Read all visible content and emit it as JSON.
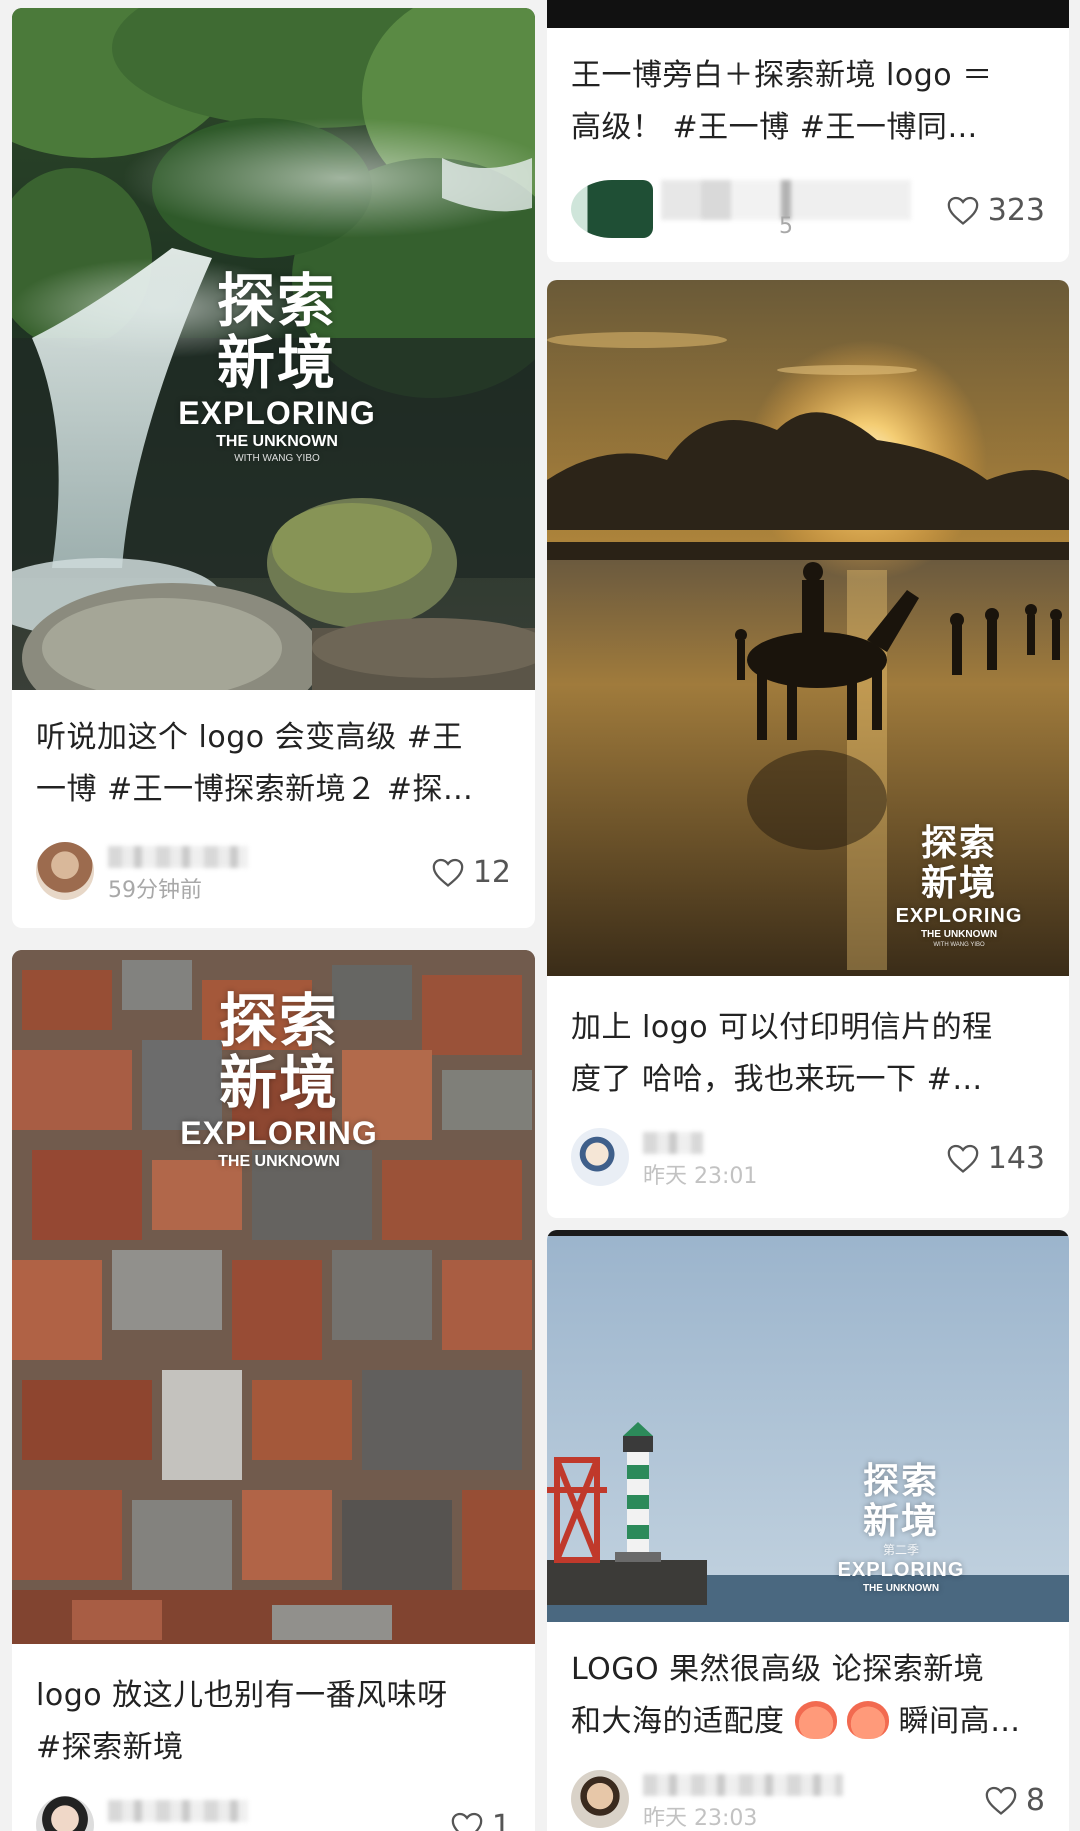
{
  "logo": {
    "cn_line1": "探索",
    "cn_line2": "新境",
    "en": "EXPLORING",
    "sub": "THE UNKNOWN",
    "tiny": "WITH WANG YIBO",
    "season": "第二季"
  },
  "posts": [
    {
      "caption_line1": "听说加这个 logo 会变高级 #王",
      "caption_line2": "一博 #王一博探索新境２ #探…",
      "time": "59分钟前",
      "likes": "12"
    },
    {
      "caption_line1": "王一博旁白＋探索新境 logo ＝",
      "caption_line2": "高级！ #王一博 #王一博同…",
      "time": "5",
      "likes": "323"
    },
    {
      "caption_line1": "加上 logo 可以付印明信片的程",
      "caption_line2": "度了 哈哈，我也来玩一下 #…",
      "time": "昨天 23:01",
      "likes": "143"
    },
    {
      "caption_line1": "logo 放这儿也别有一番风味呀",
      "caption_line2": "#探索新境",
      "time": "",
      "likes": "1"
    },
    {
      "caption_line1": "LOGO 果然很高级 论探索新境",
      "caption_line2": "和大海的适配度",
      "caption_line2_tail": "瞬间高…",
      "time": "昨天 23:03",
      "likes": "8"
    }
  ]
}
